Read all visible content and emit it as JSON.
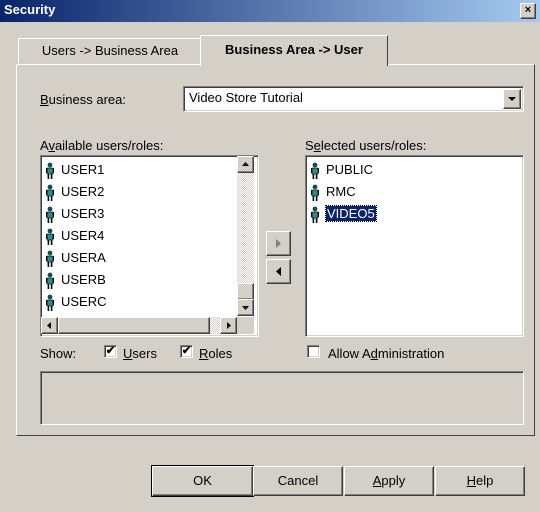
{
  "window": {
    "title": "Security",
    "close": "×"
  },
  "tabs": [
    {
      "label": "Users -> Business Area"
    },
    {
      "label": "Business Area -> User"
    }
  ],
  "business_area": {
    "label_prefix": "B",
    "label_rest": "usiness area:",
    "value": "Video Store Tutorial"
  },
  "available": {
    "label_pre": "A",
    "label_u": "v",
    "label_rest": "ailable users/roles:",
    "items": [
      "USER1",
      "USER2",
      "USER3",
      "USER4",
      "USERA",
      "USERB",
      "USERC"
    ]
  },
  "selected": {
    "label_pre": "S",
    "label_u": "e",
    "label_rest": "lected users/roles:",
    "items": [
      "PUBLIC",
      "RMC",
      "VIDEO5"
    ]
  },
  "show": {
    "label": "Show:",
    "users_u": "U",
    "users_rest": "sers",
    "roles_u": "R",
    "roles_rest": "oles",
    "users_checked": true,
    "roles_checked": true
  },
  "allow_admin": {
    "label_pre": "Allow A",
    "label_u": "d",
    "label_rest": "ministration",
    "checked": false
  },
  "buttons": {
    "ok": "OK",
    "cancel": "Cancel",
    "apply_u": "A",
    "apply_rest": "pply",
    "help_u": "H",
    "help_rest": "elp"
  }
}
